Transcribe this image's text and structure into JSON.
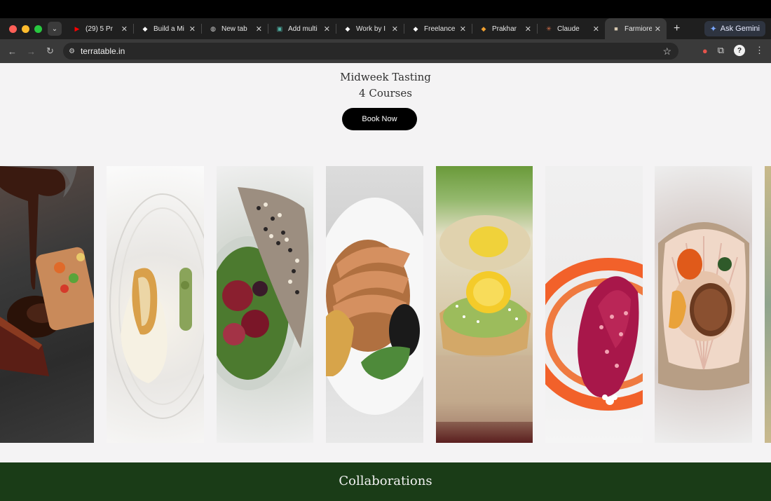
{
  "browser": {
    "tabs": [
      {
        "label": "(29) 5 Pr",
        "favicon": "youtube-icon",
        "color": "#ff0000",
        "glyph": "▶",
        "active": false
      },
      {
        "label": "Build a Mi",
        "favicon": "diamond-icon",
        "color": "#ffffff",
        "glyph": "◆",
        "active": false
      },
      {
        "label": "New tab",
        "favicon": "globe-icon",
        "color": "#cfcfcf",
        "glyph": "◍",
        "active": false
      },
      {
        "label": "Add multi",
        "favicon": "image-icon",
        "color": "#4fb3a6",
        "glyph": "▣",
        "active": false
      },
      {
        "label": "Work by I",
        "favicon": "diamond-icon",
        "color": "#ffffff",
        "glyph": "◆",
        "active": false
      },
      {
        "label": "Freelance",
        "favicon": "diamond-icon",
        "color": "#ffffff",
        "glyph": "◆",
        "active": false
      },
      {
        "label": "Prakhar",
        "favicon": "diamond-icon",
        "color": "#f0a030",
        "glyph": "◆",
        "active": false
      },
      {
        "label": "Claude",
        "favicon": "claude-icon",
        "color": "#d9704a",
        "glyph": "✳",
        "active": false
      },
      {
        "label": "Farmiore",
        "favicon": "page-icon",
        "color": "#d8c9b0",
        "glyph": "■",
        "active": true
      }
    ],
    "gemini_label": "Ask Gemini",
    "url": "terratable.in"
  },
  "page": {
    "hero": {
      "line1": "Midweek Tasting",
      "line2": "4 Courses",
      "book_label": "Book Now"
    },
    "gallery": [
      "dish-1",
      "dish-2",
      "dish-3",
      "dish-4",
      "dish-5",
      "dish-6",
      "dish-7",
      "dish-8"
    ],
    "collab_title": "Collaborations"
  },
  "colors": {
    "page_bg": "#f4f3f4",
    "button_bg": "#000000",
    "collab_bg": "#1a3c17"
  }
}
